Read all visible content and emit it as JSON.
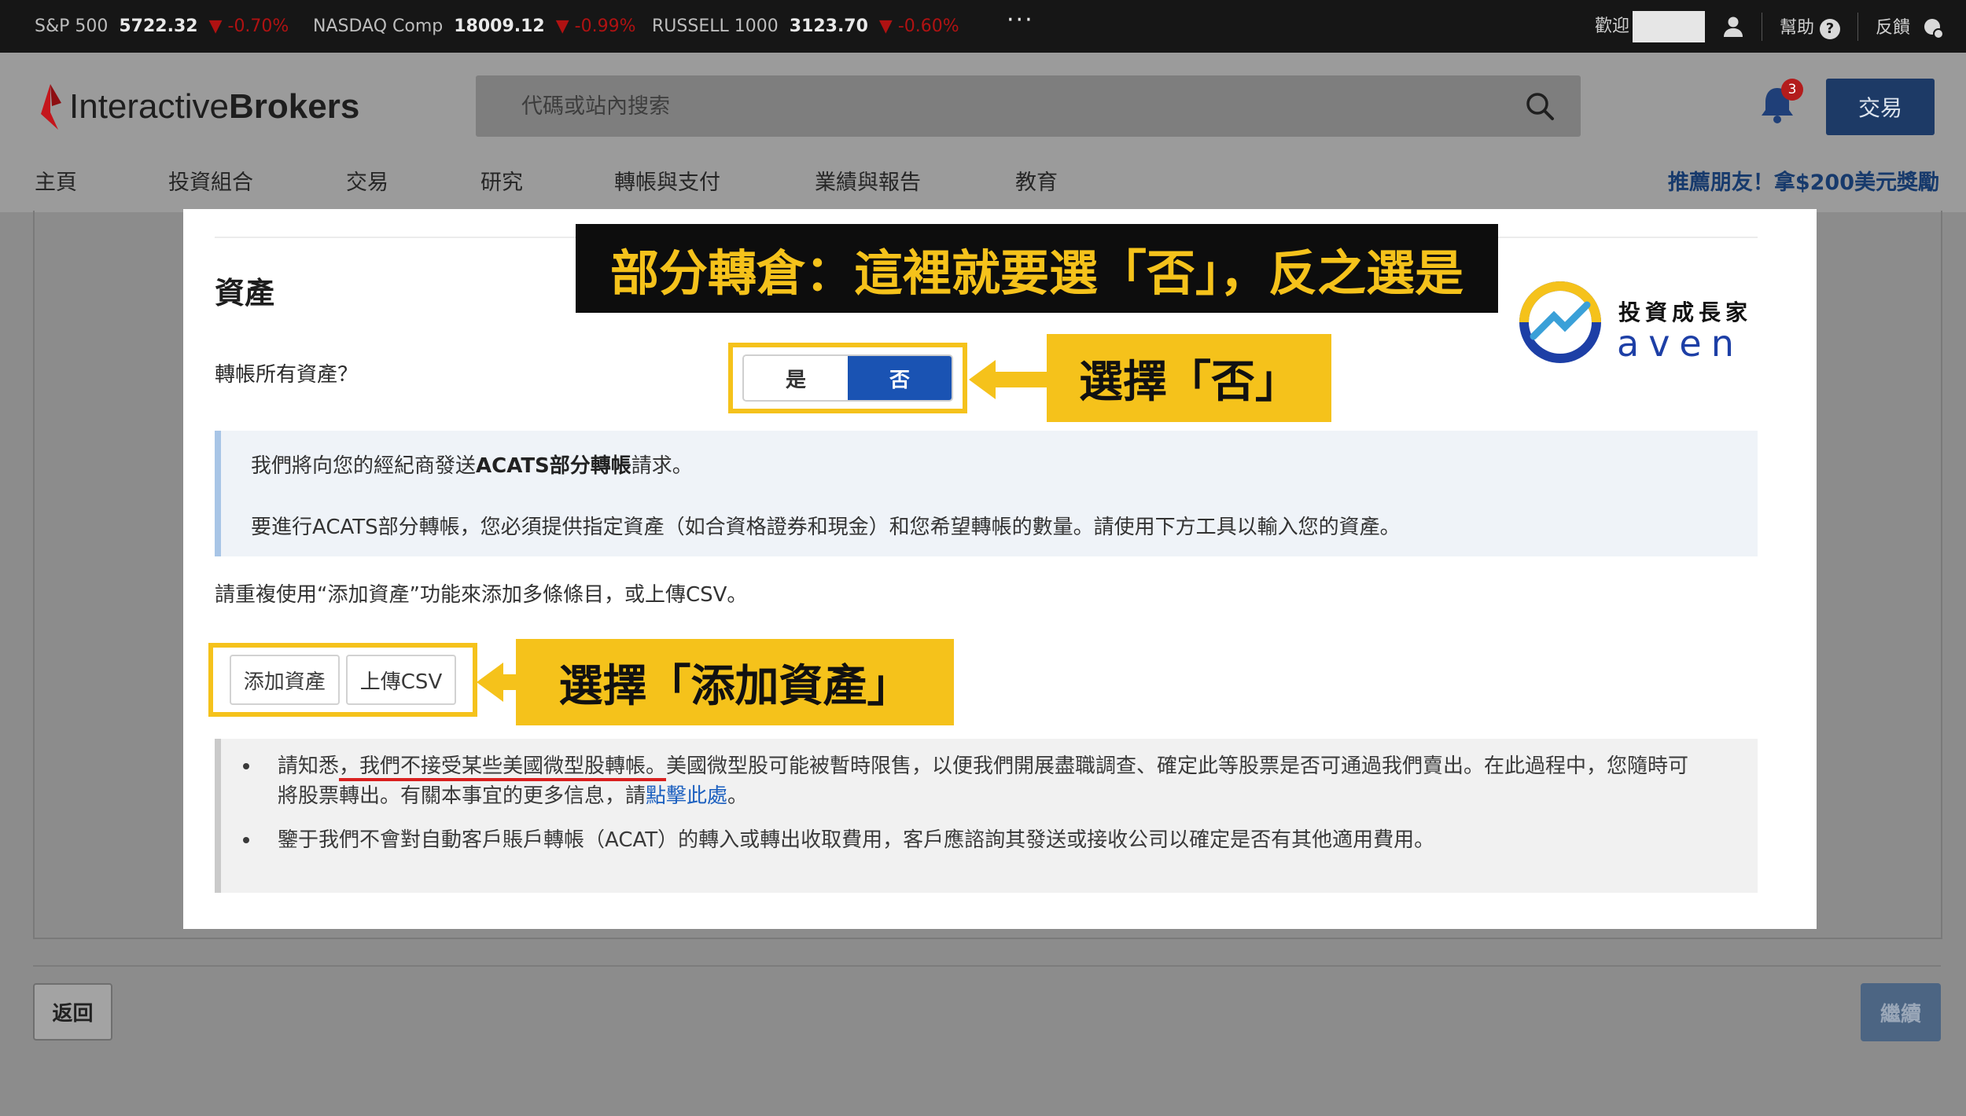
{
  "ticker": {
    "items": [
      {
        "name": "S&P 500",
        "value": "5722.32",
        "change": "-0.70%"
      },
      {
        "name": "NASDAQ Comp",
        "value": "18009.12",
        "change": "-0.99%"
      },
      {
        "name": "RUSSELL 1000",
        "value": "3123.70",
        "change": "-0.60%"
      }
    ],
    "more": "···",
    "welcome": "歡迎",
    "help": "幫助",
    "help_icon": "?",
    "feedback": "反饋",
    "down_arrow": "▼"
  },
  "header": {
    "logo_light": "Interactive",
    "logo_bold": "Brokers",
    "search_placeholder": "代碼或站內搜索",
    "notification_count": "3",
    "trade_button": "交易"
  },
  "nav": {
    "items": [
      "主頁",
      "投資組合",
      "交易",
      "研究",
      "轉帳與支付",
      "業績與報告",
      "教育"
    ],
    "promo": "推薦朋友！拿$200美元獎勵"
  },
  "form": {
    "section_title": "資產",
    "question": "轉帳所有資產？",
    "toggle_yes": "是",
    "toggle_no": "否",
    "toggle_selected": "否",
    "info_line1_pre": "我們將向您的經紀商發送",
    "info_line1_bold": "ACATS部分轉帳",
    "info_line1_post": "請求。",
    "info_line2": "要進行ACATS部分轉帳，您必須提供指定資產（如合資格證券和現金）和您希望轉帳的數量。請使用下方工具以輸入您的資產。",
    "hint": "請重複使用“添加資產”功能來添加多條條目，或上傳CSV。",
    "add_asset_button": "添加資產",
    "upload_csv_button": "上傳CSV",
    "notice_1_pre": "請知悉",
    "notice_1_underlined": "，我們不接受某些美國微型股轉帳。",
    "notice_1_post": "美國微型股可能被暫時限售，以便我們開展盡職調查、確定此等股票是否可通過我們賣出。在此過程中，您隨時可將股票轉出。有關本事宜的更多信息，請",
    "notice_1_link": "點擊此處",
    "notice_1_end": "。",
    "notice_2": "鑒于我們不會對自動客戶賬戶轉帳（ACAT）的轉入或轉出收取費用，客戶應諮詢其發送或接收公司以確定是否有其他適用費用。"
  },
  "footer": {
    "back_button": "返回",
    "continue_button": "繼續"
  },
  "annotations": {
    "banner": "部分轉倉：這裡就要選「否」，反之選是",
    "select_no": "選擇「否」",
    "select_add_asset": "選擇「添加資產」",
    "brand_cn": "投資成長家",
    "brand_en": "aven"
  },
  "colors": {
    "highlight": "#f5c21b",
    "active_toggle": "#1a53b3",
    "brand_blue": "#1d3a66",
    "down_red": "#b01212"
  }
}
